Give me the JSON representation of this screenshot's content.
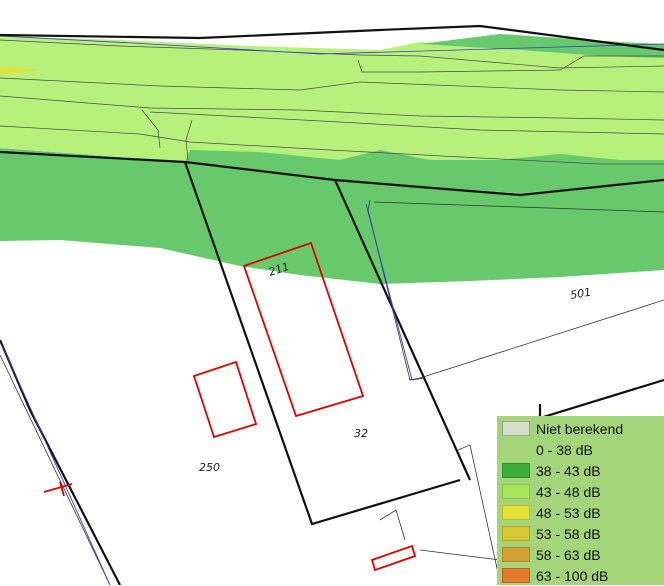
{
  "parcel_labels": {
    "p211": "211",
    "p501": "501",
    "p32": "32",
    "p250": "250"
  },
  "legend": {
    "items": [
      {
        "label": "Niet berekend",
        "color": "#d3dfc9",
        "border": "#9aa890"
      },
      {
        "label": "0 - 38 dB",
        "color": "#a4d57a",
        "border": "#a4d57a"
      },
      {
        "label": "38 - 43 dB",
        "color": "#3dac3a",
        "border": "#2f8f2c"
      },
      {
        "label": "43 - 48 dB",
        "color": "#a9e65b",
        "border": "#8ec744"
      },
      {
        "label": "48 - 53 dB",
        "color": "#e2e03a",
        "border": "#c0be23"
      },
      {
        "label": "53 - 58 dB",
        "color": "#d7c735",
        "border": "#b8a91f"
      },
      {
        "label": "58 - 63 dB",
        "color": "#d3a035",
        "border": "#b28425"
      },
      {
        "label": "63 - 100 dB",
        "color": "#e47a2c",
        "border": "#c06120"
      }
    ]
  },
  "colors": {
    "band_light": "#b8f07c",
    "band_dark": "#68c96c",
    "building_outline": "#e00000",
    "parcel_outline": "#000000",
    "road_outline": "#3a3ad0"
  }
}
